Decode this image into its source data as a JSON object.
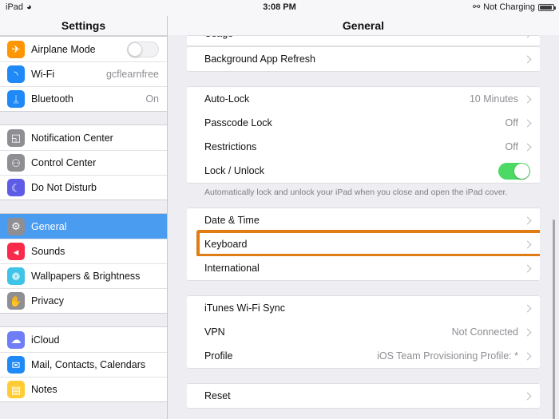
{
  "statusbar": {
    "device": "iPad",
    "wifi_icon": "wifi-icon",
    "time": "3:08 PM",
    "bluetooth_icon": "bluetooth-icon",
    "charge_state": "Not Charging",
    "battery_icon": "battery-icon"
  },
  "sidebar": {
    "title": "Settings",
    "groups": [
      {
        "items": [
          {
            "label": "Airplane Mode",
            "icon": "airplane-icon",
            "icon_color": "#ff9500",
            "control": "toggle",
            "value": ""
          },
          {
            "label": "Wi-Fi",
            "icon": "wifi-icon",
            "icon_color": "#1f8af7",
            "control": "value",
            "value": "gcflearnfree"
          },
          {
            "label": "Bluetooth",
            "icon": "bluetooth-icon",
            "icon_color": "#1f8af7",
            "control": "value",
            "value": "On"
          }
        ]
      },
      {
        "items": [
          {
            "label": "Notification Center",
            "icon": "notification-center-icon",
            "icon_color": "#8e8e93",
            "control": "none",
            "value": ""
          },
          {
            "label": "Control Center",
            "icon": "control-center-icon",
            "icon_color": "#8e8e93",
            "control": "none",
            "value": ""
          },
          {
            "label": "Do Not Disturb",
            "icon": "moon-icon",
            "icon_color": "#5e5ce6",
            "control": "none",
            "value": ""
          }
        ]
      },
      {
        "items": [
          {
            "label": "General",
            "icon": "gear-icon",
            "icon_color": "#8e8e93",
            "control": "none",
            "value": "",
            "selected": true
          },
          {
            "label": "Sounds",
            "icon": "speaker-icon",
            "icon_color": "#fa2a4b",
            "control": "none",
            "value": ""
          },
          {
            "label": "Wallpapers & Brightness",
            "icon": "flower-icon",
            "icon_color": "#3fc4e8",
            "control": "none",
            "value": ""
          },
          {
            "label": "Privacy",
            "icon": "hand-icon",
            "icon_color": "#8e8e93",
            "control": "none",
            "value": ""
          }
        ]
      },
      {
        "items": [
          {
            "label": "iCloud",
            "icon": "cloud-icon",
            "icon_color": "#6f7df7",
            "control": "none",
            "value": ""
          },
          {
            "label": "Mail, Contacts, Calendars",
            "icon": "envelope-icon",
            "icon_color": "#1f8af7",
            "control": "none",
            "value": ""
          },
          {
            "label": "Notes",
            "icon": "notes-icon",
            "icon_color": "#ffcc33",
            "control": "none",
            "value": ""
          }
        ]
      }
    ]
  },
  "main": {
    "title": "General",
    "clipped_row": {
      "label": "Usage"
    },
    "groups": [
      {
        "rows": [
          {
            "label": "Background App Refresh",
            "value": "",
            "control": "chevron"
          }
        ]
      },
      {
        "rows": [
          {
            "label": "Auto-Lock",
            "value": "10 Minutes",
            "control": "chevron"
          },
          {
            "label": "Passcode Lock",
            "value": "Off",
            "control": "chevron"
          },
          {
            "label": "Restrictions",
            "value": "Off",
            "control": "chevron"
          },
          {
            "label": "Lock / Unlock",
            "value": "",
            "control": "toggle-on"
          }
        ],
        "footnote": "Automatically lock and unlock your iPad when you close and open the iPad cover."
      },
      {
        "rows": [
          {
            "label": "Date & Time",
            "value": "",
            "control": "chevron"
          },
          {
            "label": "Keyboard",
            "value": "",
            "control": "chevron",
            "highlighted": true
          },
          {
            "label": "International",
            "value": "",
            "control": "chevron"
          }
        ]
      },
      {
        "rows": [
          {
            "label": "iTunes Wi-Fi Sync",
            "value": "",
            "control": "chevron"
          },
          {
            "label": "VPN",
            "value": "Not Connected",
            "control": "chevron"
          },
          {
            "label": "Profile",
            "value": "iOS Team Provisioning Profile: *",
            "control": "chevron"
          }
        ]
      },
      {
        "rows": [
          {
            "label": "Reset",
            "value": "",
            "control": "chevron"
          }
        ]
      }
    ],
    "highlight_color": "#e07c14"
  }
}
